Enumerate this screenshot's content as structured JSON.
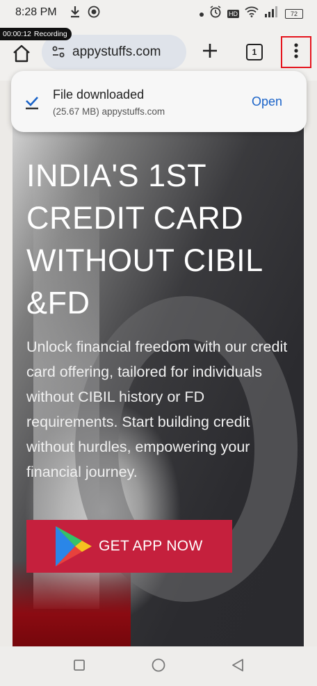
{
  "status_bar": {
    "time": "8:28 PM",
    "battery": "72",
    "hd_label": "HD"
  },
  "recording": {
    "timer": "00:00:12",
    "label": "Recording"
  },
  "toolbar": {
    "url": "appystuffs.com",
    "tab_count": "1"
  },
  "download": {
    "title": "File downloaded",
    "details": "(25.67 MB) appystuffs.com",
    "action": "Open"
  },
  "page": {
    "headline": "INDIA'S 1ST CREDIT CARD WITHOUT CIBIL &FD",
    "description": "Unlock financial freedom with our credit card offering, tailored for individuals without CIBIL history or FD requirements. Start building credit without hurdles, empowering your financial journey.",
    "cta_label": "GET APP NOW"
  },
  "colors": {
    "accent_red": "#c5203d",
    "highlight_box": "#e5141d",
    "link_blue": "#1a63c8"
  },
  "icons": [
    "download-icon",
    "record-icon",
    "alarm-icon",
    "wifi-icon",
    "signal-icon",
    "battery-icon",
    "home-icon",
    "site-settings-icon",
    "plus-icon",
    "more-menu-icon",
    "download-done-icon",
    "play-store-icon",
    "square-icon",
    "circle-icon",
    "back-triangle-icon"
  ]
}
